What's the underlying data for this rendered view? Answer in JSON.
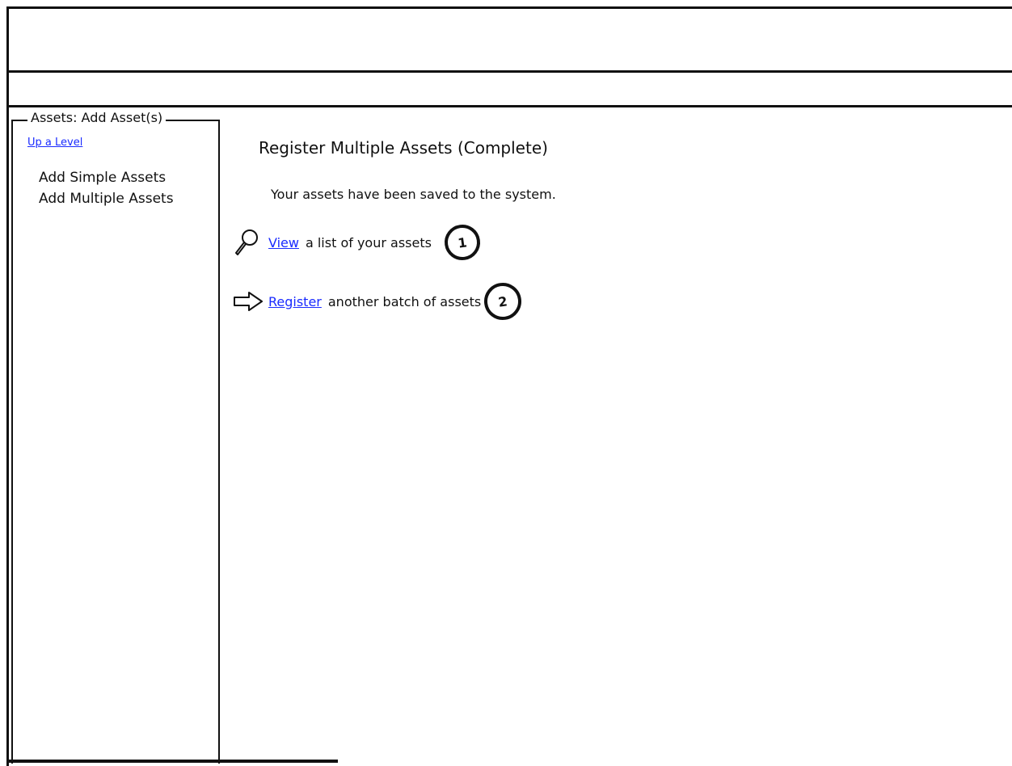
{
  "sidebar": {
    "title": "Assets: Add Asset(s)",
    "up_link": "Up a Level",
    "items": [
      {
        "label": "Add Simple Assets"
      },
      {
        "label": "Add Multiple Assets"
      }
    ]
  },
  "main": {
    "title": "Register Multiple Assets (Complete)",
    "message": "Your assets have been saved to the system.",
    "actions": [
      {
        "icon": "magnifier-icon",
        "link": "View",
        "text": "a list of your assets",
        "marker": "1"
      },
      {
        "icon": "arrow-right-icon",
        "link": "Register",
        "text": "another batch of assets",
        "marker": "2"
      }
    ]
  },
  "colors": {
    "link": "#1a2bff",
    "border": "#111111",
    "background": "#ffffff"
  }
}
